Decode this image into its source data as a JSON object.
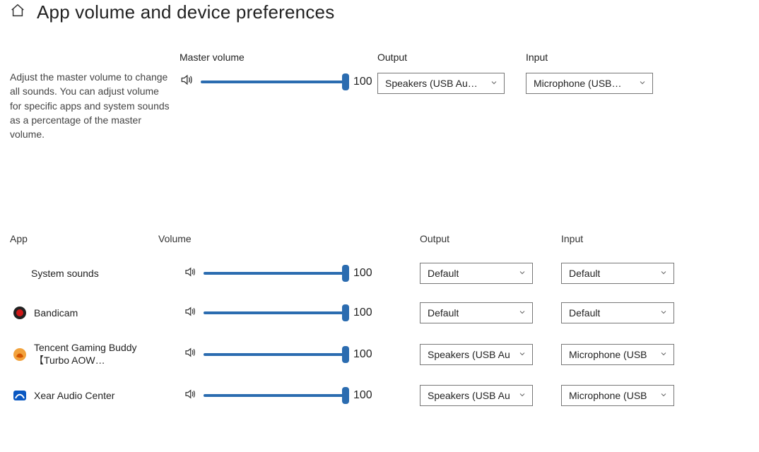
{
  "title": "App volume and device preferences",
  "master": {
    "description": "Adjust the master volume to change all sounds. You can adjust volume for specific apps and system sounds as a percentage of the master volume.",
    "labels": {
      "volume": "Master volume",
      "output": "Output",
      "input": "Input"
    },
    "volume": 100,
    "output": "Speakers (USB Au…",
    "input": "Microphone (USB…"
  },
  "appsHeader": {
    "app": "App",
    "volume": "Volume",
    "output": "Output",
    "input": "Input"
  },
  "apps": [
    {
      "name": "System sounds",
      "icon": "none",
      "volume": 100,
      "output": "Default",
      "input": "Default"
    },
    {
      "name": "Bandicam",
      "icon": "bandicam",
      "volume": 100,
      "output": "Default",
      "input": "Default"
    },
    {
      "name": "Tencent Gaming Buddy【Turbo AOW…",
      "icon": "tencent",
      "volume": 100,
      "output": "Speakers (USB Au",
      "input": "Microphone (USB"
    },
    {
      "name": "Xear Audio Center",
      "icon": "xear",
      "volume": 100,
      "output": "Speakers (USB Au",
      "input": "Microphone (USB"
    }
  ]
}
